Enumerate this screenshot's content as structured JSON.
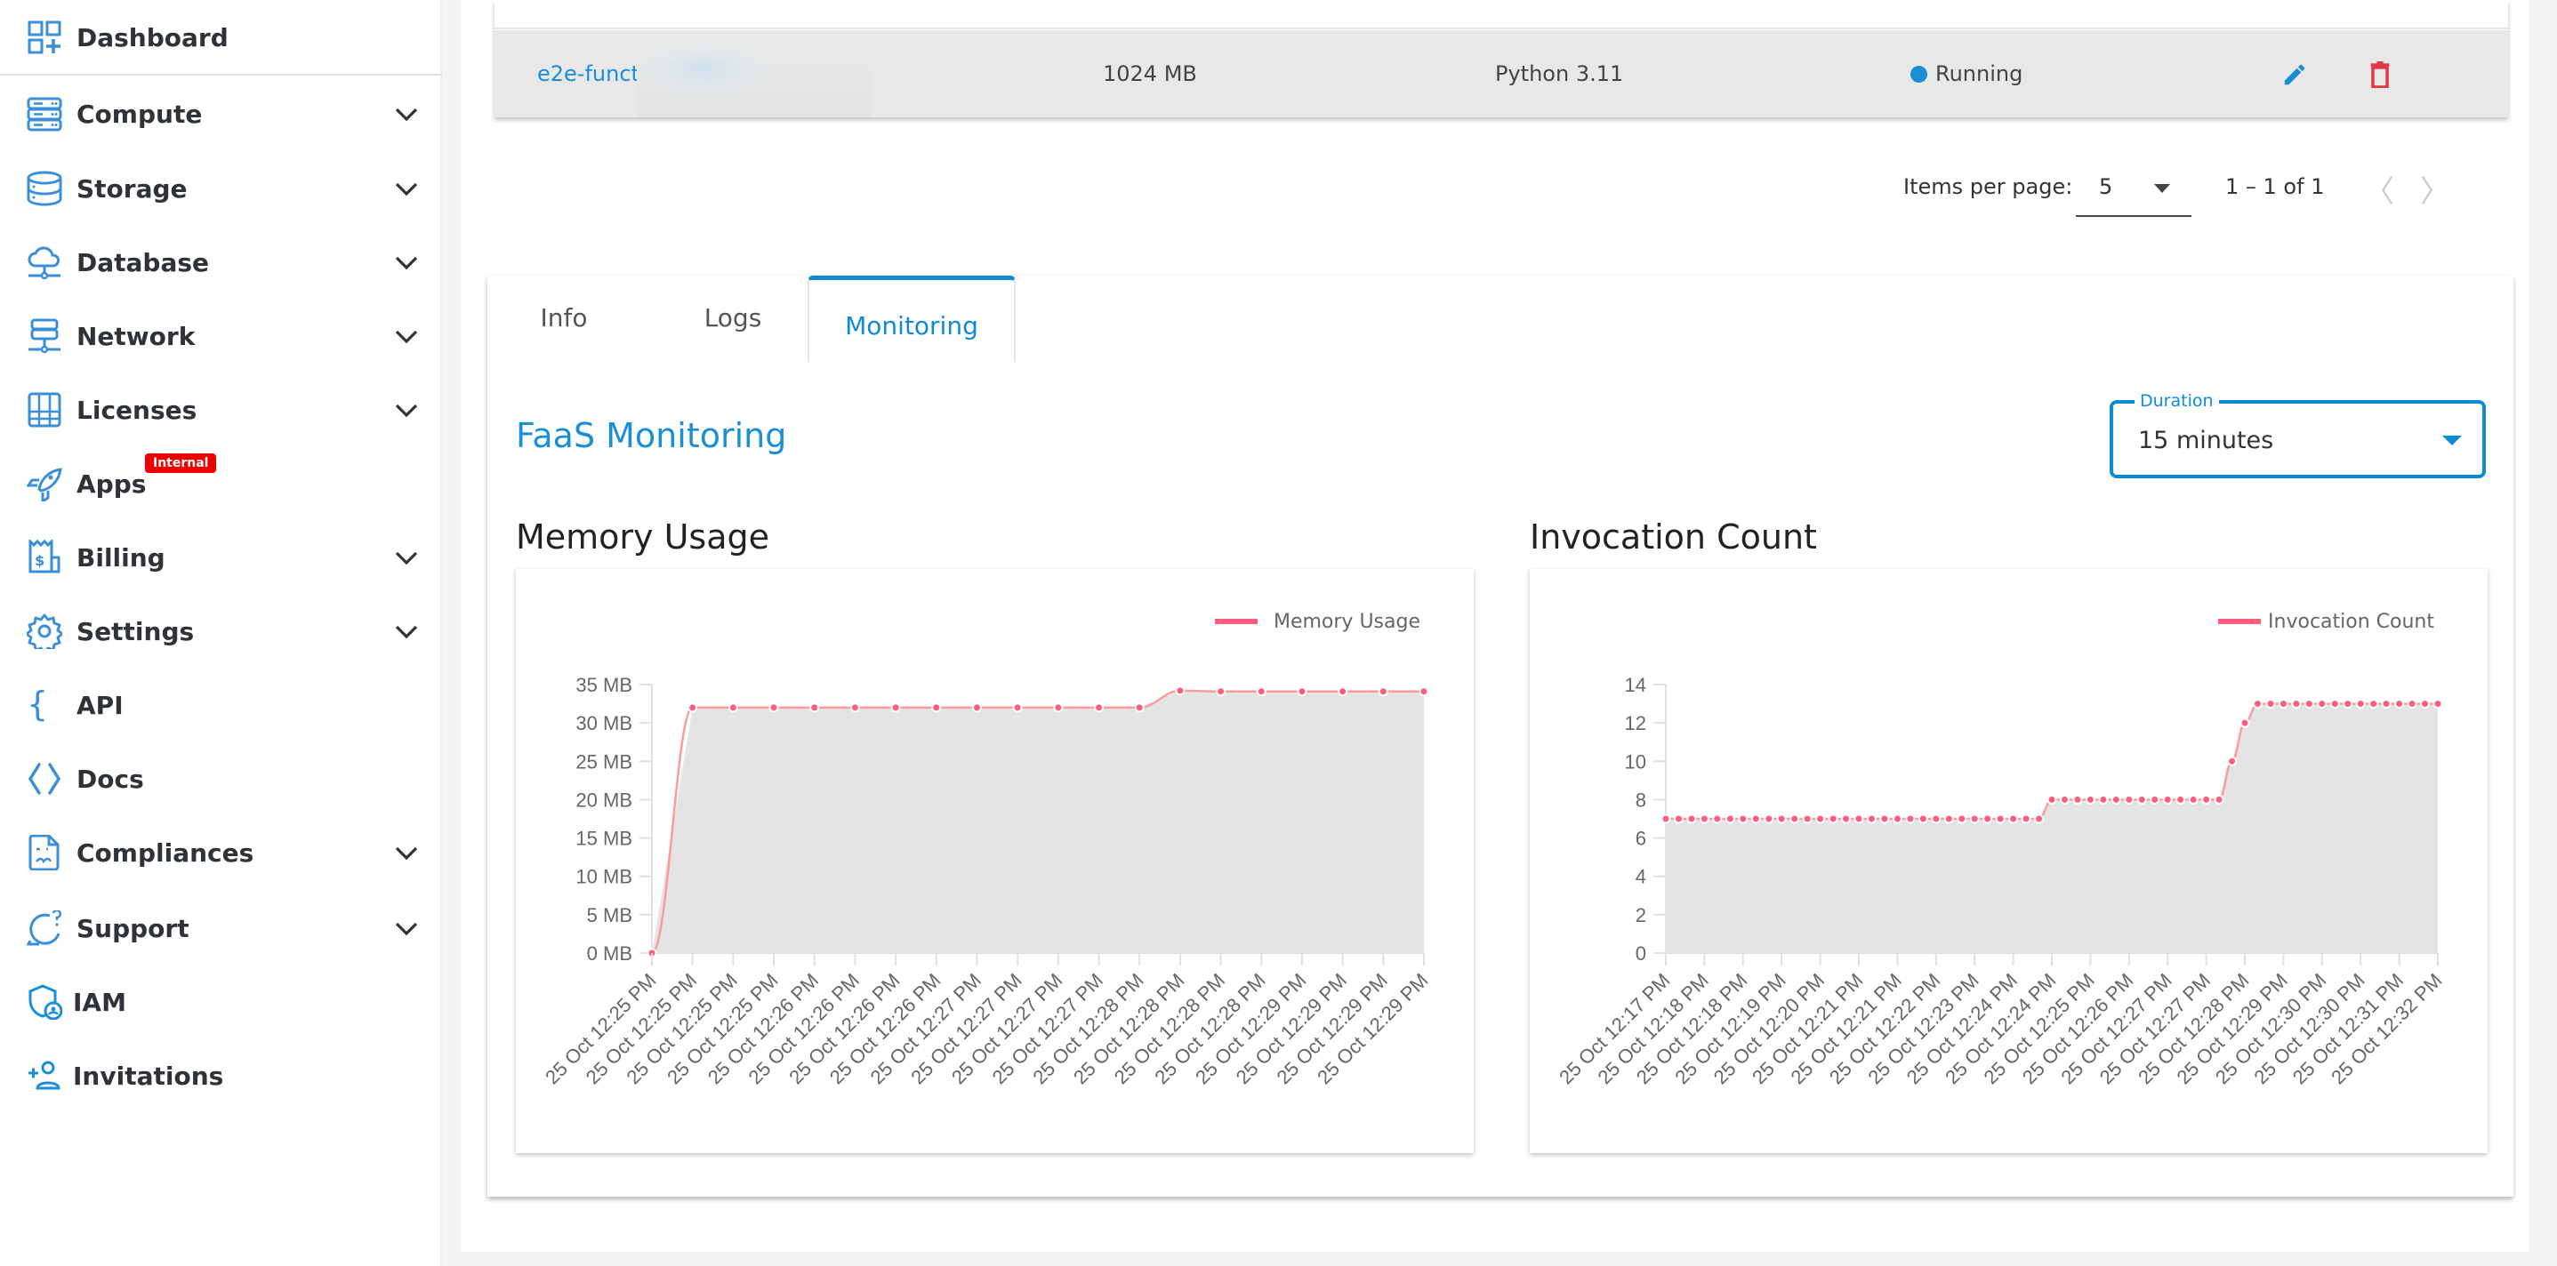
{
  "sidebar": {
    "items": [
      {
        "label": "Dashboard",
        "icon": "dashboard-grid-icon",
        "expandable": false
      },
      {
        "label": "Compute",
        "icon": "server-stack-icon",
        "expandable": true
      },
      {
        "label": "Storage",
        "icon": "database-cylinder-icon",
        "expandable": true
      },
      {
        "label": "Database",
        "icon": "cloud-network-icon",
        "expandable": true
      },
      {
        "label": "Network",
        "icon": "network-server-icon",
        "expandable": true
      },
      {
        "label": "Licenses",
        "icon": "licenses-grid-icon",
        "expandable": true
      },
      {
        "label": "Apps",
        "icon": "rocket-icon",
        "expandable": false,
        "badge": "Internal"
      },
      {
        "label": "Billing",
        "icon": "billing-receipt-icon",
        "expandable": true
      },
      {
        "label": "Settings",
        "icon": "gear-icon",
        "expandable": true
      },
      {
        "label": "API",
        "icon": "curly-braces-icon",
        "expandable": false
      },
      {
        "label": "Docs",
        "icon": "code-brackets-icon",
        "expandable": false
      },
      {
        "label": "Compliances",
        "icon": "document-icon",
        "expandable": true
      },
      {
        "label": "Support",
        "icon": "chat-question-icon",
        "expandable": true
      },
      {
        "label": "IAM",
        "icon": "shield-user-icon",
        "expandable": false
      },
      {
        "label": "Invitations",
        "icon": "add-user-icon",
        "expandable": false
      }
    ]
  },
  "table": {
    "row": {
      "name": "e2e-functi",
      "memory": "1024 MB",
      "runtime": "Python 3.11",
      "status": "Running"
    }
  },
  "paginator": {
    "items_per_page_label": "Items per page:",
    "items_per_page_value": "5",
    "range_label": "1 – 1 of 1"
  },
  "tabs": [
    {
      "label": "Info",
      "active": false
    },
    {
      "label": "Logs",
      "active": false
    },
    {
      "label": "Monitoring",
      "active": true
    }
  ],
  "monitoring": {
    "title": "FaaS Monitoring",
    "duration": {
      "label": "Duration",
      "value": "15 minutes"
    }
  },
  "colors": {
    "accent": "#0f8bd6",
    "series_line": "#ff9a9a",
    "series_point": "#ff5c7f",
    "area_fill": "#e4e4e4",
    "delete": "#e03a4a",
    "badge": "#ee0000"
  },
  "chart_data": [
    {
      "type": "area",
      "title": "Memory Usage",
      "legend": [
        "Memory Usage"
      ],
      "legend_position": "top-right",
      "xlabel": "",
      "ylabel": "",
      "y_unit": "MB",
      "ylim": [
        0,
        35
      ],
      "yticks": [
        "0 MB",
        "5 MB",
        "10 MB",
        "15 MB",
        "20 MB",
        "25 MB",
        "30 MB",
        "35 MB"
      ],
      "ytick_values": [
        0,
        5,
        10,
        15,
        20,
        25,
        30,
        35
      ],
      "grid": false,
      "categories": [
        "25 Oct 12:25 PM",
        "25 Oct 12:25 PM",
        "25 Oct 12:25 PM",
        "25 Oct 12:25 PM",
        "25 Oct 12:26 PM",
        "25 Oct 12:26 PM",
        "25 Oct 12:26 PM",
        "25 Oct 12:26 PM",
        "25 Oct 12:27 PM",
        "25 Oct 12:27 PM",
        "25 Oct 12:27 PM",
        "25 Oct 12:27 PM",
        "25 Oct 12:28 PM",
        "25 Oct 12:28 PM",
        "25 Oct 12:28 PM",
        "25 Oct 12:28 PM",
        "25 Oct 12:29 PM",
        "25 Oct 12:29 PM",
        "25 Oct 12:29 PM",
        "25 Oct 12:29 PM"
      ],
      "points_per_tick": 1,
      "series": [
        {
          "name": "Memory Usage",
          "values": [
            0,
            32,
            32,
            32,
            32,
            32,
            32,
            32,
            32,
            32,
            32,
            32,
            32,
            34.2,
            34.1,
            34.1,
            34.1,
            34.1,
            34.1,
            34.1
          ]
        }
      ]
    },
    {
      "type": "area",
      "title": "Invocation Count",
      "legend": [
        "Invocation Count"
      ],
      "legend_position": "top-right",
      "xlabel": "",
      "ylabel": "",
      "ylim": [
        0,
        14
      ],
      "yticks": [
        "0",
        "2",
        "4",
        "6",
        "8",
        "10",
        "12",
        "14"
      ],
      "ytick_values": [
        0,
        2,
        4,
        6,
        8,
        10,
        12,
        14
      ],
      "grid": false,
      "categories": [
        "25 Oct 12:17 PM",
        "25 Oct 12:18 PM",
        "25 Oct 12:18 PM",
        "25 Oct 12:19 PM",
        "25 Oct 12:20 PM",
        "25 Oct 12:21 PM",
        "25 Oct 12:21 PM",
        "25 Oct 12:22 PM",
        "25 Oct 12:23 PM",
        "25 Oct 12:24 PM",
        "25 Oct 12:24 PM",
        "25 Oct 12:25 PM",
        "25 Oct 12:26 PM",
        "25 Oct 12:27 PM",
        "25 Oct 12:27 PM",
        "25 Oct 12:28 PM",
        "25 Oct 12:29 PM",
        "25 Oct 12:30 PM",
        "25 Oct 12:30 PM",
        "25 Oct 12:31 PM",
        "25 Oct 12:32 PM"
      ],
      "points_per_tick": 3,
      "series": [
        {
          "name": "Invocation Count",
          "values": [
            7,
            7,
            7,
            7,
            7,
            7,
            7,
            7,
            7,
            7,
            7,
            7,
            7,
            7,
            7,
            7,
            7,
            7,
            7,
            7,
            7,
            7,
            7,
            7,
            7,
            7,
            7,
            7,
            7,
            7,
            8,
            8,
            8,
            8,
            8,
            8,
            8,
            8,
            8,
            8,
            8,
            8,
            8,
            8,
            10,
            12,
            13,
            13,
            13,
            13,
            13,
            13,
            13,
            13,
            13,
            13,
            13,
            13,
            13,
            13,
            13
          ]
        }
      ]
    }
  ]
}
